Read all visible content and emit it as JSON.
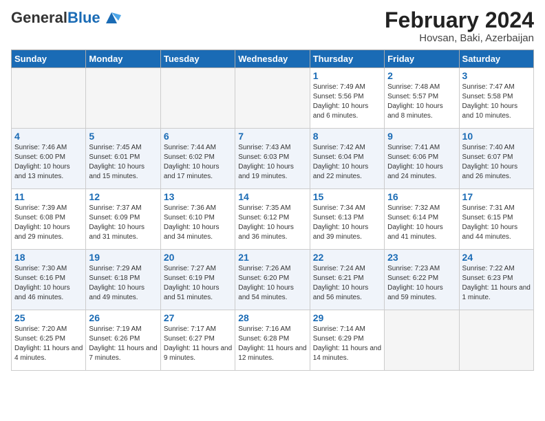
{
  "header": {
    "logo_general": "General",
    "logo_blue": "Blue",
    "month_year": "February 2024",
    "location": "Hovsan, Baki, Azerbaijan"
  },
  "weekdays": [
    "Sunday",
    "Monday",
    "Tuesday",
    "Wednesday",
    "Thursday",
    "Friday",
    "Saturday"
  ],
  "weeks": [
    [
      {
        "day": "",
        "info": ""
      },
      {
        "day": "",
        "info": ""
      },
      {
        "day": "",
        "info": ""
      },
      {
        "day": "",
        "info": ""
      },
      {
        "day": "1",
        "info": "Sunrise: 7:49 AM\nSunset: 5:56 PM\nDaylight: 10 hours and 6 minutes."
      },
      {
        "day": "2",
        "info": "Sunrise: 7:48 AM\nSunset: 5:57 PM\nDaylight: 10 hours and 8 minutes."
      },
      {
        "day": "3",
        "info": "Sunrise: 7:47 AM\nSunset: 5:58 PM\nDaylight: 10 hours and 10 minutes."
      }
    ],
    [
      {
        "day": "4",
        "info": "Sunrise: 7:46 AM\nSunset: 6:00 PM\nDaylight: 10 hours and 13 minutes."
      },
      {
        "day": "5",
        "info": "Sunrise: 7:45 AM\nSunset: 6:01 PM\nDaylight: 10 hours and 15 minutes."
      },
      {
        "day": "6",
        "info": "Sunrise: 7:44 AM\nSunset: 6:02 PM\nDaylight: 10 hours and 17 minutes."
      },
      {
        "day": "7",
        "info": "Sunrise: 7:43 AM\nSunset: 6:03 PM\nDaylight: 10 hours and 19 minutes."
      },
      {
        "day": "8",
        "info": "Sunrise: 7:42 AM\nSunset: 6:04 PM\nDaylight: 10 hours and 22 minutes."
      },
      {
        "day": "9",
        "info": "Sunrise: 7:41 AM\nSunset: 6:06 PM\nDaylight: 10 hours and 24 minutes."
      },
      {
        "day": "10",
        "info": "Sunrise: 7:40 AM\nSunset: 6:07 PM\nDaylight: 10 hours and 26 minutes."
      }
    ],
    [
      {
        "day": "11",
        "info": "Sunrise: 7:39 AM\nSunset: 6:08 PM\nDaylight: 10 hours and 29 minutes."
      },
      {
        "day": "12",
        "info": "Sunrise: 7:37 AM\nSunset: 6:09 PM\nDaylight: 10 hours and 31 minutes."
      },
      {
        "day": "13",
        "info": "Sunrise: 7:36 AM\nSunset: 6:10 PM\nDaylight: 10 hours and 34 minutes."
      },
      {
        "day": "14",
        "info": "Sunrise: 7:35 AM\nSunset: 6:12 PM\nDaylight: 10 hours and 36 minutes."
      },
      {
        "day": "15",
        "info": "Sunrise: 7:34 AM\nSunset: 6:13 PM\nDaylight: 10 hours and 39 minutes."
      },
      {
        "day": "16",
        "info": "Sunrise: 7:32 AM\nSunset: 6:14 PM\nDaylight: 10 hours and 41 minutes."
      },
      {
        "day": "17",
        "info": "Sunrise: 7:31 AM\nSunset: 6:15 PM\nDaylight: 10 hours and 44 minutes."
      }
    ],
    [
      {
        "day": "18",
        "info": "Sunrise: 7:30 AM\nSunset: 6:16 PM\nDaylight: 10 hours and 46 minutes."
      },
      {
        "day": "19",
        "info": "Sunrise: 7:29 AM\nSunset: 6:18 PM\nDaylight: 10 hours and 49 minutes."
      },
      {
        "day": "20",
        "info": "Sunrise: 7:27 AM\nSunset: 6:19 PM\nDaylight: 10 hours and 51 minutes."
      },
      {
        "day": "21",
        "info": "Sunrise: 7:26 AM\nSunset: 6:20 PM\nDaylight: 10 hours and 54 minutes."
      },
      {
        "day": "22",
        "info": "Sunrise: 7:24 AM\nSunset: 6:21 PM\nDaylight: 10 hours and 56 minutes."
      },
      {
        "day": "23",
        "info": "Sunrise: 7:23 AM\nSunset: 6:22 PM\nDaylight: 10 hours and 59 minutes."
      },
      {
        "day": "24",
        "info": "Sunrise: 7:22 AM\nSunset: 6:23 PM\nDaylight: 11 hours and 1 minute."
      }
    ],
    [
      {
        "day": "25",
        "info": "Sunrise: 7:20 AM\nSunset: 6:25 PM\nDaylight: 11 hours and 4 minutes."
      },
      {
        "day": "26",
        "info": "Sunrise: 7:19 AM\nSunset: 6:26 PM\nDaylight: 11 hours and 7 minutes."
      },
      {
        "day": "27",
        "info": "Sunrise: 7:17 AM\nSunset: 6:27 PM\nDaylight: 11 hours and 9 minutes."
      },
      {
        "day": "28",
        "info": "Sunrise: 7:16 AM\nSunset: 6:28 PM\nDaylight: 11 hours and 12 minutes."
      },
      {
        "day": "29",
        "info": "Sunrise: 7:14 AM\nSunset: 6:29 PM\nDaylight: 11 hours and 14 minutes."
      },
      {
        "day": "",
        "info": ""
      },
      {
        "day": "",
        "info": ""
      }
    ]
  ]
}
